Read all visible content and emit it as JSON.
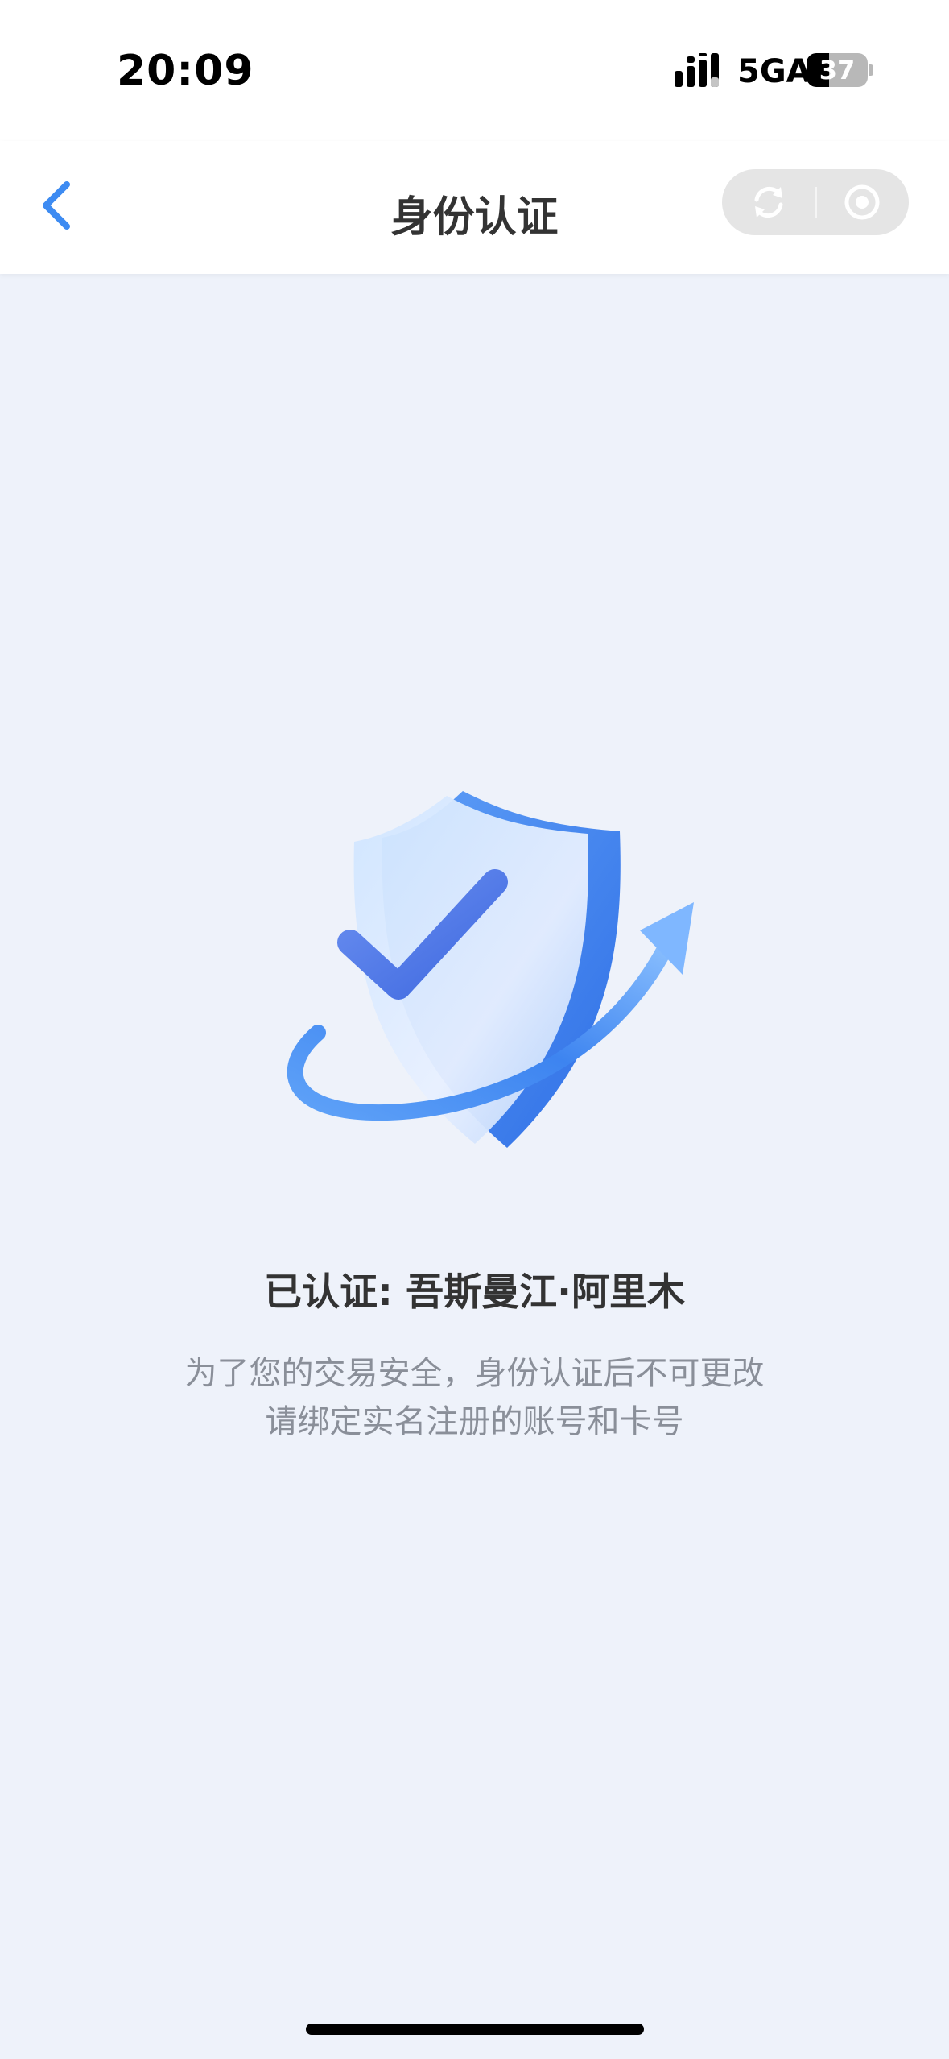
{
  "status_bar": {
    "time": "20:09",
    "network": "5GA",
    "battery_level": "37",
    "battery_fraction": 0.37
  },
  "nav": {
    "title": "身份认证",
    "back_icon": "chevron-left-icon",
    "capsule_icons": [
      "refresh-icon",
      "record-icon"
    ]
  },
  "content": {
    "illustration_icon": "shield-check-icon",
    "verified_name": "已认证: 吾斯曼江·阿里木",
    "description_line_1": "为了您的交易安全，身份认证后不可更改",
    "description_line_2": "请绑定实名注册的账号和卡号"
  },
  "colors": {
    "accent": "#3d8bf2",
    "background": "#eef2fa",
    "title": "#333333",
    "description": "#8a8f99"
  }
}
